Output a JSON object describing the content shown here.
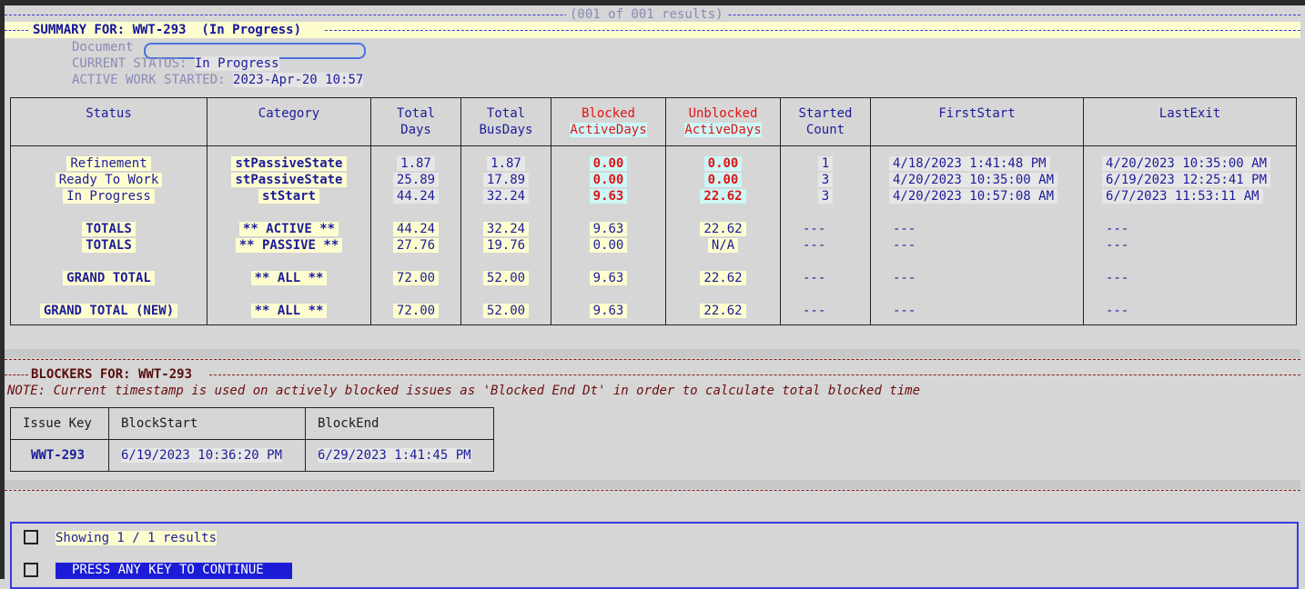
{
  "header": {
    "results": "(001 of 001 results)",
    "summary_title": "SUMMARY FOR: WWT-293  (In Progress)"
  },
  "meta": {
    "document_label": "Document",
    "current_status_label": "CURRENT STATUS:",
    "current_status_value": "In Progress",
    "active_work_label": "ACTIVE WORK STARTED:",
    "active_work_value": "2023-Apr-20 10:57"
  },
  "summary_table": {
    "columns": [
      [
        "Status",
        ""
      ],
      [
        "Category",
        ""
      ],
      [
        "Total",
        "Days"
      ],
      [
        "Total",
        "BusDays"
      ],
      [
        "Blocked",
        "ActiveDays"
      ],
      [
        "Unblocked",
        "ActiveDays"
      ],
      [
        "Started",
        "Count"
      ],
      [
        "FirstStart",
        ""
      ],
      [
        "LastExit",
        ""
      ]
    ],
    "rows": [
      [
        "Refinement",
        "stPassiveState",
        "1.87",
        "1.87",
        "0.00",
        "0.00",
        "1",
        "4/18/2023 1:41:48 PM",
        "4/20/2023 10:35:00 AM"
      ],
      [
        "Ready To Work",
        "stPassiveState",
        "25.89",
        "17.89",
        "0.00",
        "0.00",
        "3",
        "4/20/2023 10:35:00 AM",
        "6/19/2023 12:25:41 PM"
      ],
      [
        "In Progress",
        "stStart",
        "44.24",
        "32.24",
        "9.63",
        "22.62",
        "3",
        "4/20/2023 10:57:08 AM",
        "6/7/2023 11:53:11 AM"
      ]
    ],
    "totals": [
      [
        "TOTALS",
        "** ACTIVE **",
        "44.24",
        "32.24",
        "9.63",
        "22.62",
        "---",
        "---",
        "---"
      ],
      [
        "TOTALS",
        "** PASSIVE **",
        "27.76",
        "19.76",
        "0.00",
        "N/A",
        "---",
        "---",
        "---"
      ],
      [
        "GRAND TOTAL",
        "** ALL **",
        "72.00",
        "52.00",
        "9.63",
        "22.62",
        "---",
        "---",
        "---"
      ],
      [
        "GRAND TOTAL (NEW)",
        "** ALL **",
        "72.00",
        "52.00",
        "9.63",
        "22.62",
        "---",
        "---",
        "---"
      ]
    ]
  },
  "blockers": {
    "title": "BLOCKERS FOR: WWT-293",
    "note": "NOTE: Current timestamp is used on actively blocked issues as 'Blocked End Dt' in order to calculate total blocked time",
    "columns": [
      "Issue Key",
      "BlockStart",
      "BlockEnd"
    ],
    "row": [
      "WWT-293",
      "6/19/2023 10:36:20 PM",
      "6/29/2023 1:41:45 PM"
    ]
  },
  "footer": {
    "showing": "Showing 1 / 1 results",
    "press": "PRESS ANY KEY TO CONTINUE"
  },
  "colors": {
    "accent_blue": "#1c1c9c",
    "blocked_red": "#e01414",
    "highlight_yellow": "#fdfdd0",
    "highlight_cyan": "#cdf7f7"
  }
}
